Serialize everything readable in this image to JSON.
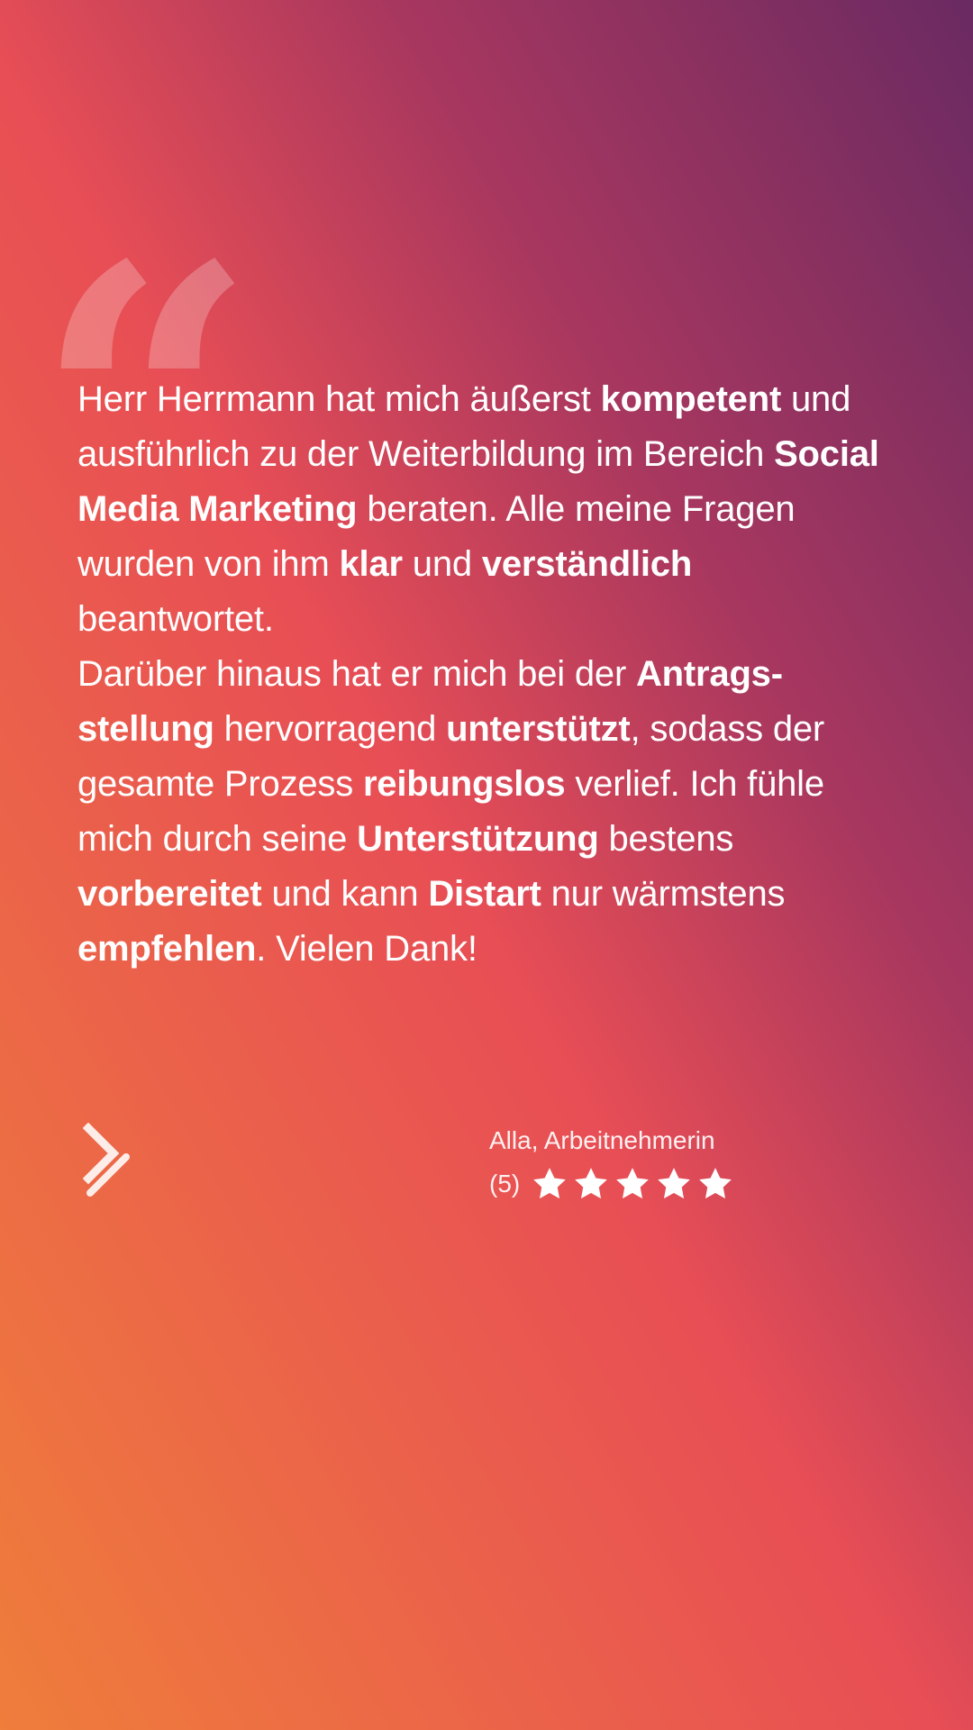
{
  "quote_icon": "quote-open-icon",
  "review": {
    "segments": [
      {
        "text": "Herr Herrmann hat mich äußerst ",
        "bold": false
      },
      {
        "text": "kompetent",
        "bold": true
      },
      {
        "text": " und ausführlich zu der Weiterbildung im Bereich ",
        "bold": false
      },
      {
        "text": "Social Media Marketing",
        "bold": true
      },
      {
        "text": " beraten. Alle meine Fragen wurden von ihm ",
        "bold": false
      },
      {
        "text": "klar",
        "bold": true
      },
      {
        "text": " und ",
        "bold": false
      },
      {
        "text": "verständlich",
        "bold": true
      },
      {
        "text": " beantwortet.",
        "bold": false
      },
      {
        "text": "\n",
        "bold": false
      },
      {
        "text": "Darüber hinaus hat er mich bei der ",
        "bold": false
      },
      {
        "text": "Antrags-stellung",
        "bold": true
      },
      {
        "text": " hervorragend ",
        "bold": false
      },
      {
        "text": "unterstützt",
        "bold": true
      },
      {
        "text": ", sodass der gesamte Prozess ",
        "bold": false
      },
      {
        "text": "reibungslos",
        "bold": true
      },
      {
        "text": " verlief. Ich fühle mich durch seine ",
        "bold": false
      },
      {
        "text": "Unterstützung",
        "bold": true
      },
      {
        "text": " bestens ",
        "bold": false
      },
      {
        "text": "vorbereitet",
        "bold": true
      },
      {
        "text": " und kann ",
        "bold": false
      },
      {
        "text": "Distart",
        "bold": true
      },
      {
        "text": " nur wärmstens ",
        "bold": false
      },
      {
        "text": "empfehlen",
        "bold": true
      },
      {
        "text": ". Vielen Dank!",
        "bold": false
      }
    ]
  },
  "brand_logo": "distart-logo-icon",
  "author": {
    "name": "Alla, Arbeitnehmerin"
  },
  "rating": {
    "count_label": "(5)",
    "stars": 5,
    "max": 5,
    "star_icon": "star-icon",
    "star_color": "#ffffff"
  },
  "colors": {
    "gradient_bottom_left": "#ef7d3b",
    "gradient_middle": "#e84e55",
    "gradient_top_right": "#6a2a62"
  }
}
